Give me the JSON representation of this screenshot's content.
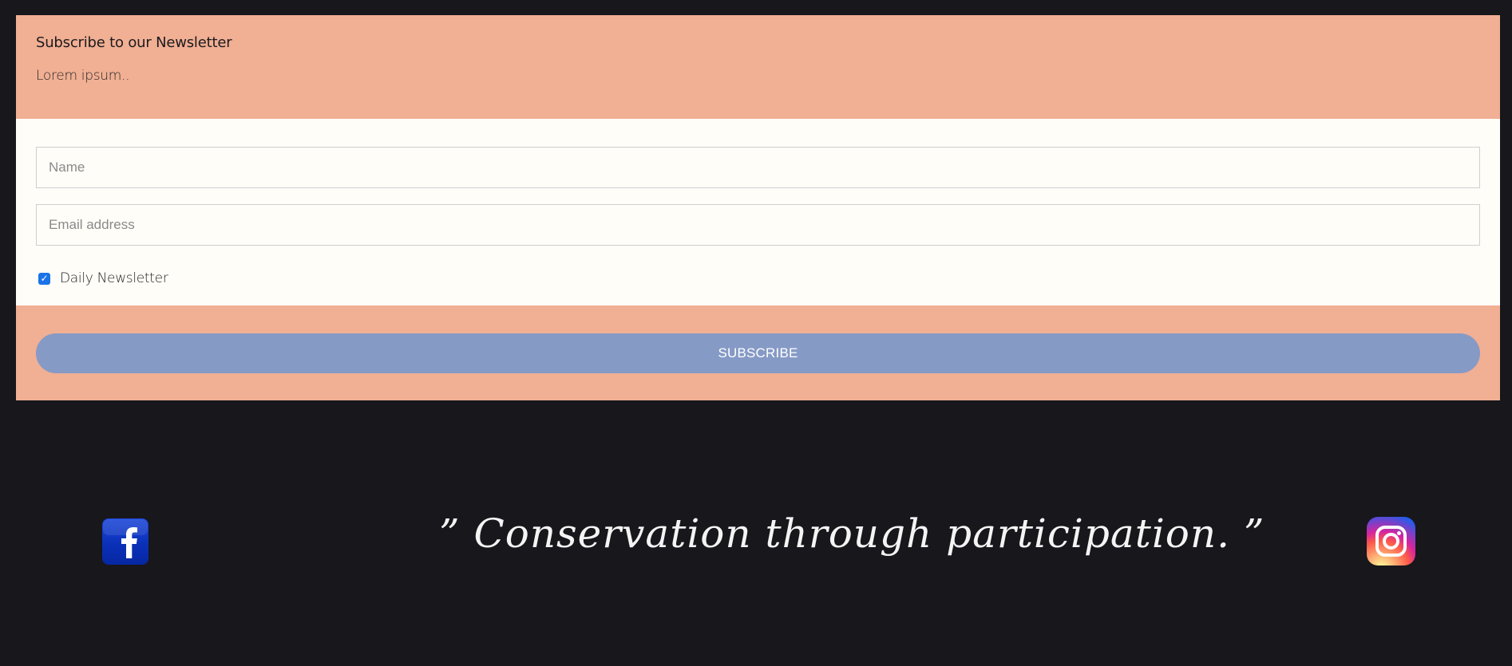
{
  "newsletter": {
    "title": "Subscribe to our Newsletter",
    "description": "Lorem ipsum..",
    "name_placeholder": "Name",
    "email_placeholder": "Email address",
    "checkbox_label": "Daily Newsletter",
    "checkbox_checked": true,
    "subscribe_label": "SUBSCRIBE"
  },
  "footer": {
    "quote": "” Conservation through participation. ”",
    "social": [
      "facebook-icon",
      "instagram-icon"
    ]
  },
  "colors": {
    "background": "#17171c",
    "panel_accent": "#f1af93",
    "form_background": "#fffdf8",
    "button": "#869ac6",
    "facebook_blue": "#0a2fb6"
  }
}
